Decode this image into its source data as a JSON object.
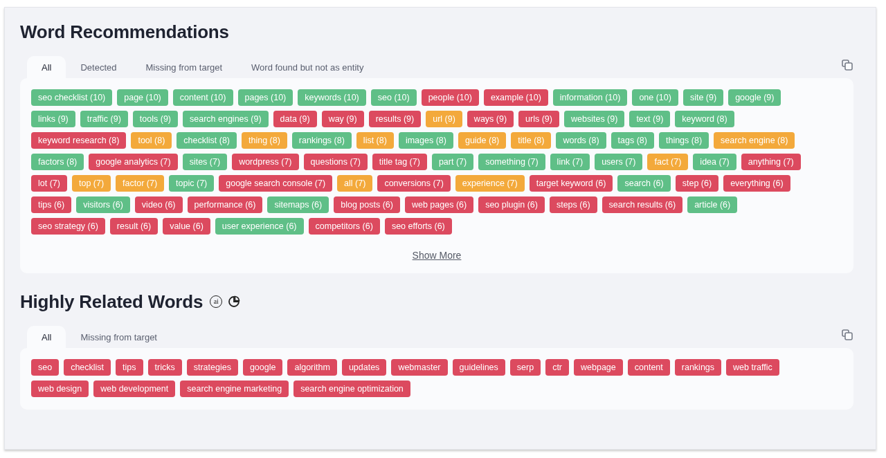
{
  "sections": [
    {
      "title": "Word Recommendations",
      "tabs": [
        {
          "label": "All",
          "selected": true
        },
        {
          "label": "Detected",
          "selected": false
        },
        {
          "label": "Missing from target",
          "selected": false
        },
        {
          "label": "Word found but not as entity",
          "selected": false
        }
      ],
      "tag_rows": [
        [
          {
            "label": "seo checklist (10)",
            "color": "#5fbf87"
          },
          {
            "label": "page (10)",
            "color": "#5fbf87"
          },
          {
            "label": "content (10)",
            "color": "#5fbf87"
          },
          {
            "label": "pages (10)",
            "color": "#5fbf87"
          },
          {
            "label": "keywords (10)",
            "color": "#5fbf87"
          },
          {
            "label": "seo (10)",
            "color": "#5fbf87"
          },
          {
            "label": "people (10)",
            "color": "#dc4a5f"
          },
          {
            "label": "example (10)",
            "color": "#dc4a5f"
          },
          {
            "label": "information (10)",
            "color": "#5fbf87"
          },
          {
            "label": "one (10)",
            "color": "#5fbf87"
          },
          {
            "label": "site (9)",
            "color": "#5fbf87"
          },
          {
            "label": "google (9)",
            "color": "#5fbf87"
          }
        ],
        [
          {
            "label": "links (9)",
            "color": "#5fbf87"
          },
          {
            "label": "traffic (9)",
            "color": "#5fbf87"
          },
          {
            "label": "tools (9)",
            "color": "#5fbf87"
          },
          {
            "label": "search engines (9)",
            "color": "#5fbf87"
          },
          {
            "label": "data (9)",
            "color": "#dc4a5f"
          },
          {
            "label": "way (9)",
            "color": "#dc4a5f"
          },
          {
            "label": "results (9)",
            "color": "#dc4a5f"
          },
          {
            "label": "url (9)",
            "color": "#f3a93b"
          },
          {
            "label": "ways (9)",
            "color": "#dc4a5f"
          },
          {
            "label": "urls (9)",
            "color": "#dc4a5f"
          },
          {
            "label": "websites (9)",
            "color": "#5fbf87"
          },
          {
            "label": "text (9)",
            "color": "#5fbf87"
          },
          {
            "label": "keyword (8)",
            "color": "#5fbf87"
          }
        ],
        [
          {
            "label": "keyword research (8)",
            "color": "#dc4a5f"
          },
          {
            "label": "tool (8)",
            "color": "#f3a93b"
          },
          {
            "label": "checklist (8)",
            "color": "#5fbf87"
          },
          {
            "label": "thing (8)",
            "color": "#f3a93b"
          },
          {
            "label": "rankings (8)",
            "color": "#5fbf87"
          },
          {
            "label": "list (8)",
            "color": "#f3a93b"
          },
          {
            "label": "images (8)",
            "color": "#5fbf87"
          },
          {
            "label": "guide (8)",
            "color": "#f3a93b"
          },
          {
            "label": "title (8)",
            "color": "#f3a93b"
          },
          {
            "label": "words (8)",
            "color": "#5fbf87"
          },
          {
            "label": "tags (8)",
            "color": "#5fbf87"
          },
          {
            "label": "things (8)",
            "color": "#5fbf87"
          },
          {
            "label": "search engine (8)",
            "color": "#f3a93b"
          }
        ],
        [
          {
            "label": "factors (8)",
            "color": "#5fbf87"
          },
          {
            "label": "google analytics (7)",
            "color": "#dc4a5f"
          },
          {
            "label": "sites (7)",
            "color": "#5fbf87"
          },
          {
            "label": "wordpress (7)",
            "color": "#dc4a5f"
          },
          {
            "label": "questions (7)",
            "color": "#dc4a5f"
          },
          {
            "label": "title tag (7)",
            "color": "#dc4a5f"
          },
          {
            "label": "part (7)",
            "color": "#5fbf87"
          },
          {
            "label": "something (7)",
            "color": "#5fbf87"
          },
          {
            "label": "link (7)",
            "color": "#5fbf87"
          },
          {
            "label": "users (7)",
            "color": "#5fbf87"
          },
          {
            "label": "fact (7)",
            "color": "#f3a93b"
          },
          {
            "label": "idea (7)",
            "color": "#5fbf87"
          },
          {
            "label": "anything (7)",
            "color": "#dc4a5f"
          }
        ],
        [
          {
            "label": "lot (7)",
            "color": "#dc4a5f"
          },
          {
            "label": "top (7)",
            "color": "#f3a93b"
          },
          {
            "label": "factor (7)",
            "color": "#f3a93b"
          },
          {
            "label": "topic (7)",
            "color": "#5fbf87"
          },
          {
            "label": "google search console (7)",
            "color": "#dc4a5f"
          },
          {
            "label": "all (7)",
            "color": "#f3a93b"
          },
          {
            "label": "conversions (7)",
            "color": "#dc4a5f"
          },
          {
            "label": "experience (7)",
            "color": "#f3a93b"
          },
          {
            "label": "target keyword (6)",
            "color": "#dc4a5f"
          },
          {
            "label": "search (6)",
            "color": "#5fbf87"
          },
          {
            "label": "step (6)",
            "color": "#dc4a5f"
          },
          {
            "label": "everything (6)",
            "color": "#dc4a5f"
          }
        ],
        [
          {
            "label": "tips (6)",
            "color": "#dc4a5f"
          },
          {
            "label": "visitors (6)",
            "color": "#5fbf87"
          },
          {
            "label": "video (6)",
            "color": "#dc4a5f"
          },
          {
            "label": "performance (6)",
            "color": "#dc4a5f"
          },
          {
            "label": "sitemaps (6)",
            "color": "#5fbf87"
          },
          {
            "label": "blog posts (6)",
            "color": "#dc4a5f"
          },
          {
            "label": "web pages (6)",
            "color": "#dc4a5f"
          },
          {
            "label": "seo plugin (6)",
            "color": "#dc4a5f"
          },
          {
            "label": "steps (6)",
            "color": "#dc4a5f"
          },
          {
            "label": "search results (6)",
            "color": "#dc4a5f"
          },
          {
            "label": "article (6)",
            "color": "#5fbf87"
          }
        ],
        [
          {
            "label": "seo strategy (6)",
            "color": "#dc4a5f"
          },
          {
            "label": "result (6)",
            "color": "#dc4a5f"
          },
          {
            "label": "value (6)",
            "color": "#dc4a5f"
          },
          {
            "label": "user experience (6)",
            "color": "#5fbf87"
          },
          {
            "label": "competitors (6)",
            "color": "#dc4a5f"
          },
          {
            "label": "seo efforts (6)",
            "color": "#dc4a5f"
          }
        ]
      ],
      "show_more": "Show More"
    },
    {
      "title": "Highly Related Words",
      "badges": [
        "ai"
      ],
      "tabs": [
        {
          "label": "All",
          "selected": true
        },
        {
          "label": "Missing from target",
          "selected": false
        }
      ],
      "tag_rows": [
        [
          {
            "label": "seo",
            "color": "#dc4a5f"
          },
          {
            "label": "checklist",
            "color": "#dc4a5f"
          },
          {
            "label": "tips",
            "color": "#dc4a5f"
          },
          {
            "label": "tricks",
            "color": "#dc4a5f"
          },
          {
            "label": "strategies",
            "color": "#dc4a5f"
          },
          {
            "label": "google",
            "color": "#dc4a5f"
          },
          {
            "label": "algorithm",
            "color": "#dc4a5f"
          },
          {
            "label": "updates",
            "color": "#dc4a5f"
          },
          {
            "label": "webmaster",
            "color": "#dc4a5f"
          },
          {
            "label": "guidelines",
            "color": "#dc4a5f"
          },
          {
            "label": "serp",
            "color": "#dc4a5f"
          },
          {
            "label": "ctr",
            "color": "#dc4a5f"
          },
          {
            "label": "webpage",
            "color": "#dc4a5f"
          },
          {
            "label": "content",
            "color": "#dc4a5f"
          },
          {
            "label": "rankings",
            "color": "#dc4a5f"
          },
          {
            "label": "web traffic",
            "color": "#dc4a5f"
          }
        ],
        [
          {
            "label": "web design",
            "color": "#dc4a5f"
          },
          {
            "label": "web development",
            "color": "#dc4a5f"
          },
          {
            "label": "search engine marketing",
            "color": "#dc4a5f"
          },
          {
            "label": "search engine optimization",
            "color": "#dc4a5f"
          }
        ]
      ]
    }
  ]
}
